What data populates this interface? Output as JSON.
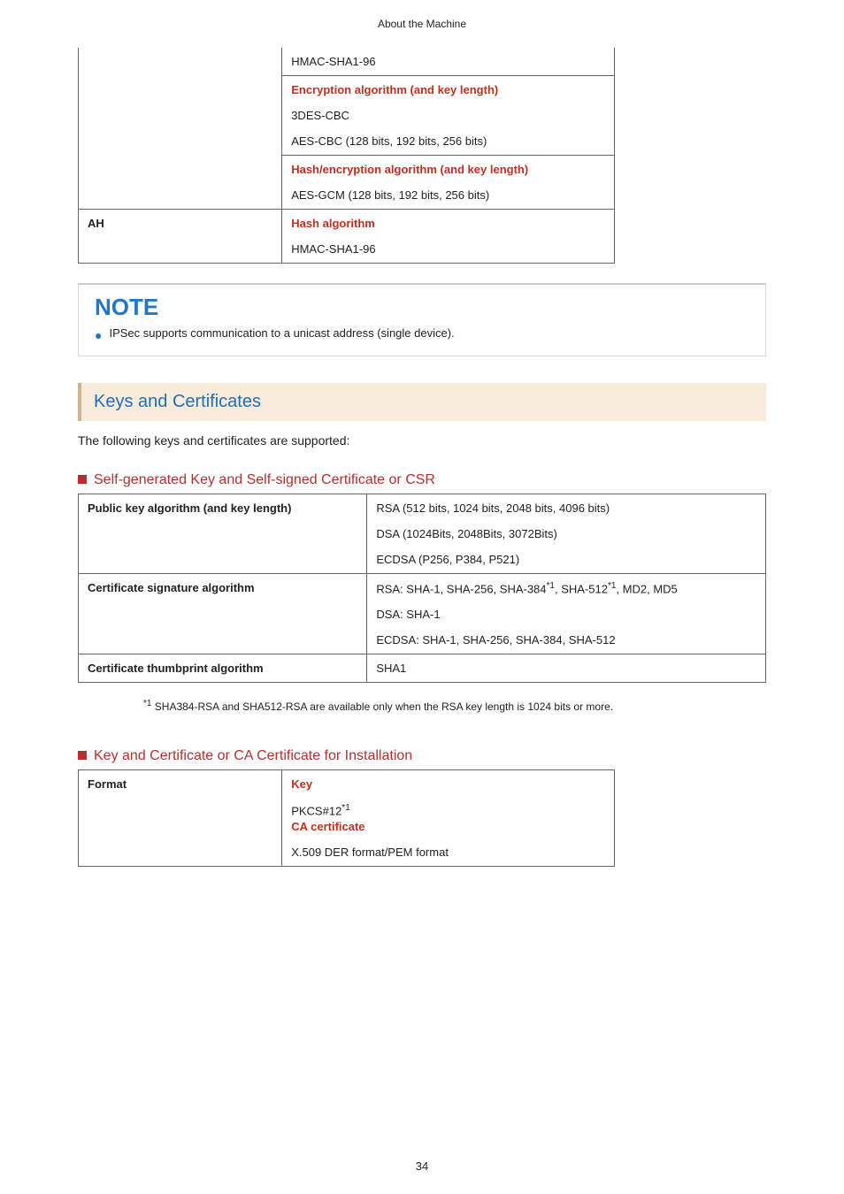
{
  "header": {
    "title": "About the Machine"
  },
  "table1": {
    "r1": {
      "v1": "HMAC-SHA1-96"
    },
    "r2": {
      "h": "Encryption algorithm (and key length)",
      "v1": "3DES-CBC",
      "v2": "AES-CBC (128 bits, 192 bits, 256 bits)"
    },
    "r3": {
      "h": "Hash/encryption algorithm (and key length)",
      "v1": "AES-GCM (128 bits, 192 bits, 256 bits)"
    },
    "r4": {
      "left": "AH",
      "h": "Hash algorithm",
      "v1": "HMAC-SHA1-96"
    }
  },
  "note": {
    "title": "NOTE",
    "item1": "IPSec supports communication to a unicast address (single device)."
  },
  "section": {
    "title": "Keys and Certificates",
    "intro": "The following keys and certificates are supported:"
  },
  "sub1": {
    "title": "Self-generated Key and Self-signed Certificate or CSR"
  },
  "table2": {
    "r1": {
      "left": "Public key algorithm (and key length)",
      "v1": "RSA (512 bits, 1024 bits, 2048 bits, 4096 bits)",
      "v2": "DSA (1024Bits, 2048Bits, 3072Bits)",
      "v3": "ECDSA (P256, P384, P521)"
    },
    "r2": {
      "left": "Certificate signature algorithm",
      "v1a": "RSA: SHA-1, SHA-256, SHA-384",
      "v1b": ", SHA-512",
      "v1c": ", MD2, MD5",
      "sup": "*1",
      "v2": "DSA: SHA-1",
      "v3": "ECDSA: SHA-1, SHA-256, SHA-384, SHA-512"
    },
    "r3": {
      "left": "Certificate thumbprint algorithm",
      "v1": "SHA1"
    }
  },
  "footnote": {
    "sup": "*1",
    "text": " SHA384-RSA and SHA512-RSA are available only when the RSA key length is 1024 bits or more."
  },
  "sub2": {
    "title": "Key and Certificate or CA Certificate for Installation"
  },
  "table3": {
    "r1": {
      "left": "Format",
      "h1": "Key",
      "v1": "PKCS#12",
      "sup": "*1",
      "h2": "CA certificate",
      "v2": "X.509 DER format/PEM format"
    }
  },
  "pagenum": "34"
}
